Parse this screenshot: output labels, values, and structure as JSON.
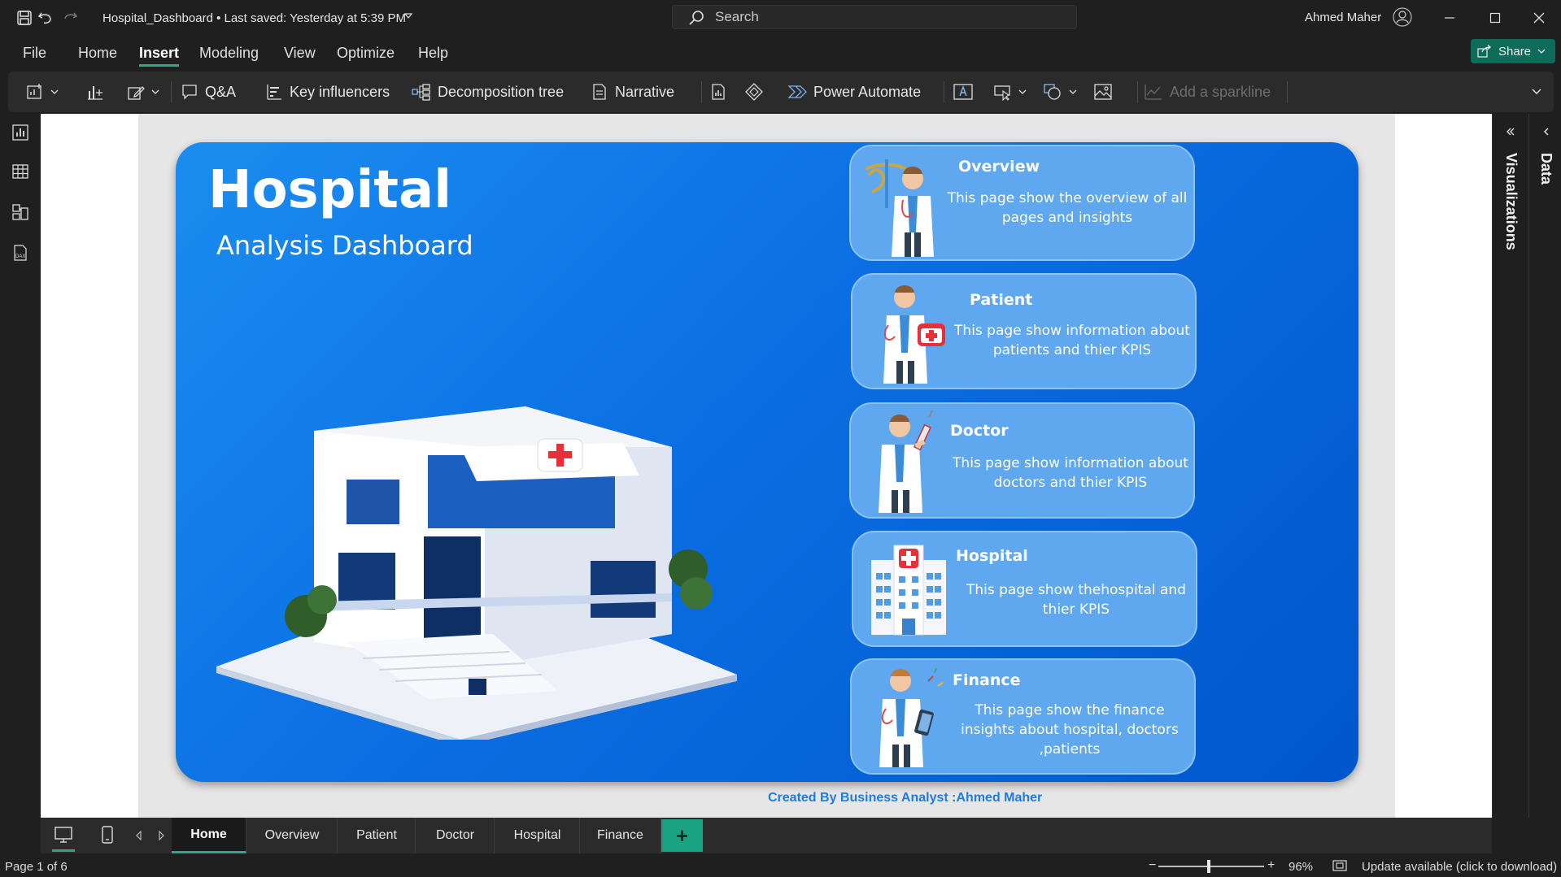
{
  "app": {
    "doc_title": "Hospital_Dashboard • Last saved: Yesterday at 5:39 PM",
    "search_placeholder": "Search",
    "user_name": "Ahmed Maher"
  },
  "menu": {
    "items": [
      "File",
      "Home",
      "Insert",
      "Modeling",
      "View",
      "Optimize",
      "Help"
    ],
    "active": "Insert",
    "share_label": "Share"
  },
  "ribbon": {
    "qa": "Q&A",
    "key_influencers": "Key influencers",
    "decomposition_tree": "Decomposition tree",
    "narrative": "Narrative",
    "power_automate": "Power Automate",
    "add_sparkline": "Add a sparkline"
  },
  "panes": {
    "visualizations": "Visualizations",
    "data": "Data"
  },
  "report": {
    "title": "Hospital",
    "subtitle": "Analysis Dashboard",
    "credit": "Created By Business Analyst :Ahmed Maher",
    "cards": [
      {
        "title": "Overview",
        "desc": "This page show the overview of all pages and insights"
      },
      {
        "title": "Patient",
        "desc": "This page show information about patients and thier KPIS"
      },
      {
        "title": "Doctor",
        "desc": "This page show information about doctors and thier KPIS"
      },
      {
        "title": "Hospital",
        "desc": "This page show thehospital and thier KPIS"
      },
      {
        "title": "Finance",
        "desc": "This page show the finance insights about hospital, doctors ,patients"
      }
    ]
  },
  "tabs": [
    "Home",
    "Overview",
    "Patient",
    "Doctor",
    "Hospital",
    "Finance"
  ],
  "tabs_active": "Home",
  "add_tab_label": "+",
  "status": {
    "page_count": "Page 1 of 6",
    "zoom": "96%",
    "update": "Update available (click to download)"
  },
  "colors": {
    "accent": "#2fa889",
    "hero_blue": "#0b6ee2",
    "card_blue": "#5fa8ef",
    "share_green": "#0f6b59"
  }
}
